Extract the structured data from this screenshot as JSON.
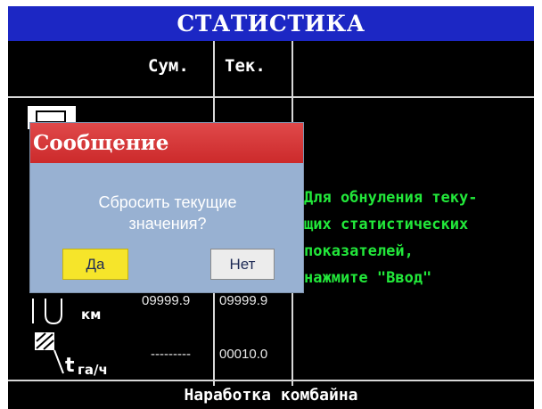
{
  "screen_title": "СТАТИСТИКА",
  "columns": {
    "total": "Сум.",
    "current": "Тек."
  },
  "rows": [
    {
      "unit": "км",
      "total": "09999.9",
      "current": "09999.9"
    },
    {
      "unit": "га/ч",
      "total": "---------",
      "current": "00010.0"
    }
  ],
  "help_text": "Для обнуления теку-\nщих статистических\nпоказателей,\nнажмите \"Ввод\"",
  "footer": "Наработка комбайна",
  "dialog": {
    "title": "Сообщение",
    "message_line1": "Сбросить текущие",
    "message_line2": "значения?",
    "yes": "Да",
    "no": "Нет"
  },
  "colors": {
    "title_bar": "#1c27c4",
    "help_text": "#22e83a",
    "dialog_title": "#d63536",
    "dialog_body": "#98b1d2",
    "yes_button": "#f6e52a"
  },
  "icons": [
    "combine-icon",
    "distance-icon",
    "area-per-hour-icon"
  ]
}
